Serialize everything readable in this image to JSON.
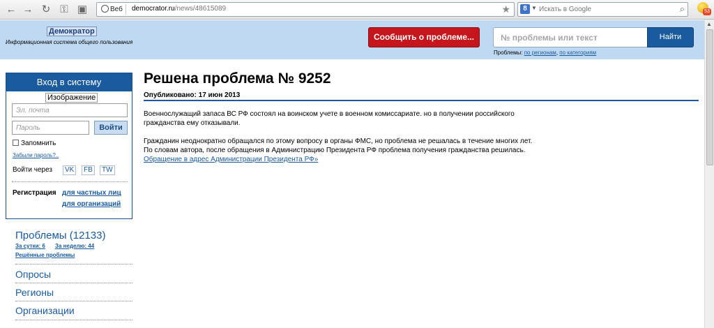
{
  "browser": {
    "web_chip": "Веб",
    "url_domain": "democrator.ru",
    "url_path": "/news/48615089",
    "search_placeholder": "Искать в Google",
    "addon_badge": "53"
  },
  "header": {
    "logo_title": "Демократор",
    "logo_subtitle": "Информационная система общего пользования",
    "report_button": "Сообщить о проблеме...",
    "search_placeholder": "№ проблемы или текст",
    "find_button": "Найти",
    "problems_label": "Проблемы:",
    "by_regions": "по регионам",
    "by_categories": "по категориям"
  },
  "login": {
    "title": "Вход в систему",
    "captcha_label": "Изображение",
    "email_placeholder": "Эл. почта",
    "password_placeholder": "Пароль",
    "login_button": "Войти",
    "remember": "Запомнить",
    "forgot": "Забыли пароль?..",
    "login_via": "Войти через",
    "vk": "VK",
    "fb": "FB",
    "tw": "TW",
    "registration": "Регистрация",
    "for_private": "для частных лиц",
    "for_orgs": "для организаций"
  },
  "nav": {
    "problems": "Проблемы (12133)",
    "per_day": "За сутки: 6",
    "per_week": "За неделю: 44",
    "resolved": "Решённые проблемы",
    "items": [
      "Опросы",
      "Регионы",
      "Организации"
    ]
  },
  "article": {
    "title": "Решена проблема № 9252",
    "published_label": "Опубликовано:",
    "published_date": "17 июн 2013",
    "para1": "Военнослужащий запаса ВС РФ состоял на воинском учете в военном комиссариате. но в получении российского гражданства ему отказывали.",
    "para2": "Гражданин неоднократно обращался по этому вопросу в органы ФМС, но проблема не решалась в течение многих лет. По словам автора, после обращения в Администрацию Президента РФ проблема получения гражданства решилась.",
    "link": "Обращение в адрес Администрации Президента РФ»"
  }
}
